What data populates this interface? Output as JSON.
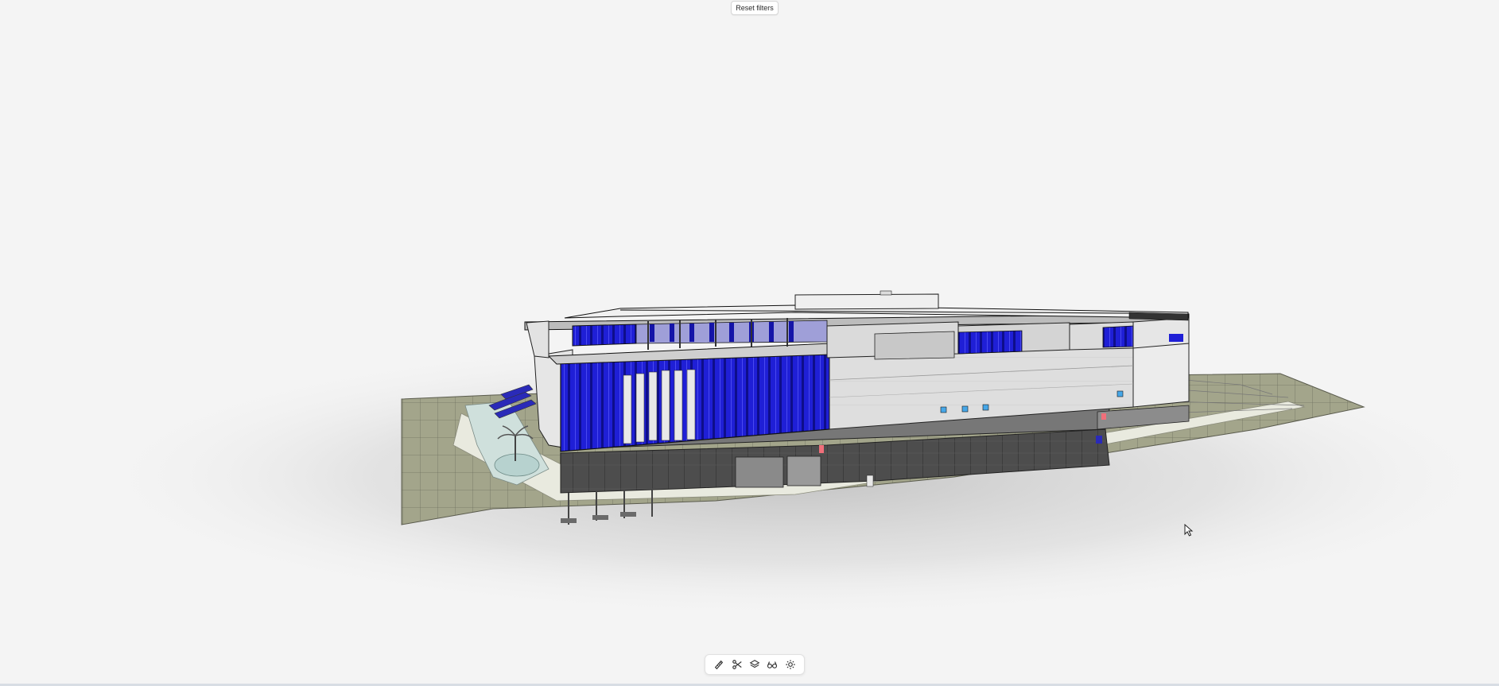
{
  "toolbar_top": {
    "reset_filters_label": "Reset filters"
  },
  "toolbar_bottom": {
    "tools": [
      {
        "name": "measure-tool",
        "icon": "ruler-icon"
      },
      {
        "name": "section-tool",
        "icon": "scissors-icon"
      },
      {
        "name": "layers-tool",
        "icon": "layers-icon"
      },
      {
        "name": "view-tool",
        "icon": "glasses-icon"
      },
      {
        "name": "settings-tool",
        "icon": "sun-icon"
      }
    ]
  },
  "colors": {
    "background": "#f4f4f4",
    "glazing": "#1f1fd6",
    "facade": "#d9d9d9",
    "podium": "#4a4a4a",
    "terrain": "#9a9c82"
  }
}
